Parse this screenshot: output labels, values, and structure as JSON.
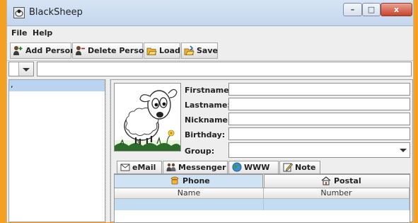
{
  "window": {
    "title": "BlackSheep",
    "min_label": "–",
    "max_label": "□",
    "close_label": "x"
  },
  "menubar": {
    "file": "File",
    "help": "Help"
  },
  "toolbar": {
    "add_person": "Add Person",
    "delete_person": "Delete Person",
    "load": "Load",
    "save": "Save"
  },
  "filter": {
    "value": ""
  },
  "contacts": [
    {
      "label": ","
    }
  ],
  "form": {
    "firstname_label": "Firstname:",
    "lastname_label": "Lastname:",
    "nickname_label": "Nickname:",
    "birthday_label": "Birthday:",
    "group_label": "Group:",
    "firstname": "",
    "lastname": "",
    "nickname": "",
    "birthday": "",
    "group": ""
  },
  "tabs": [
    {
      "label": "eMail",
      "icon": "envelope-icon"
    },
    {
      "label": "Messenger",
      "icon": "people-icon"
    },
    {
      "label": "WWW",
      "icon": "globe-icon"
    },
    {
      "label": "Note",
      "icon": "note-icon"
    }
  ],
  "subtabs": [
    {
      "label": "Phone",
      "icon": "phone-icon",
      "selected": true
    },
    {
      "label": "Postal",
      "icon": "house-icon",
      "selected": false
    }
  ],
  "phone_table": {
    "columns": [
      "Name",
      "Number"
    ],
    "rows": [
      [
        "",
        ""
      ]
    ]
  },
  "colors": {
    "accent": "#f4a020",
    "selection": "#b8d4f0",
    "tab_selected": "#cfe3f4"
  }
}
